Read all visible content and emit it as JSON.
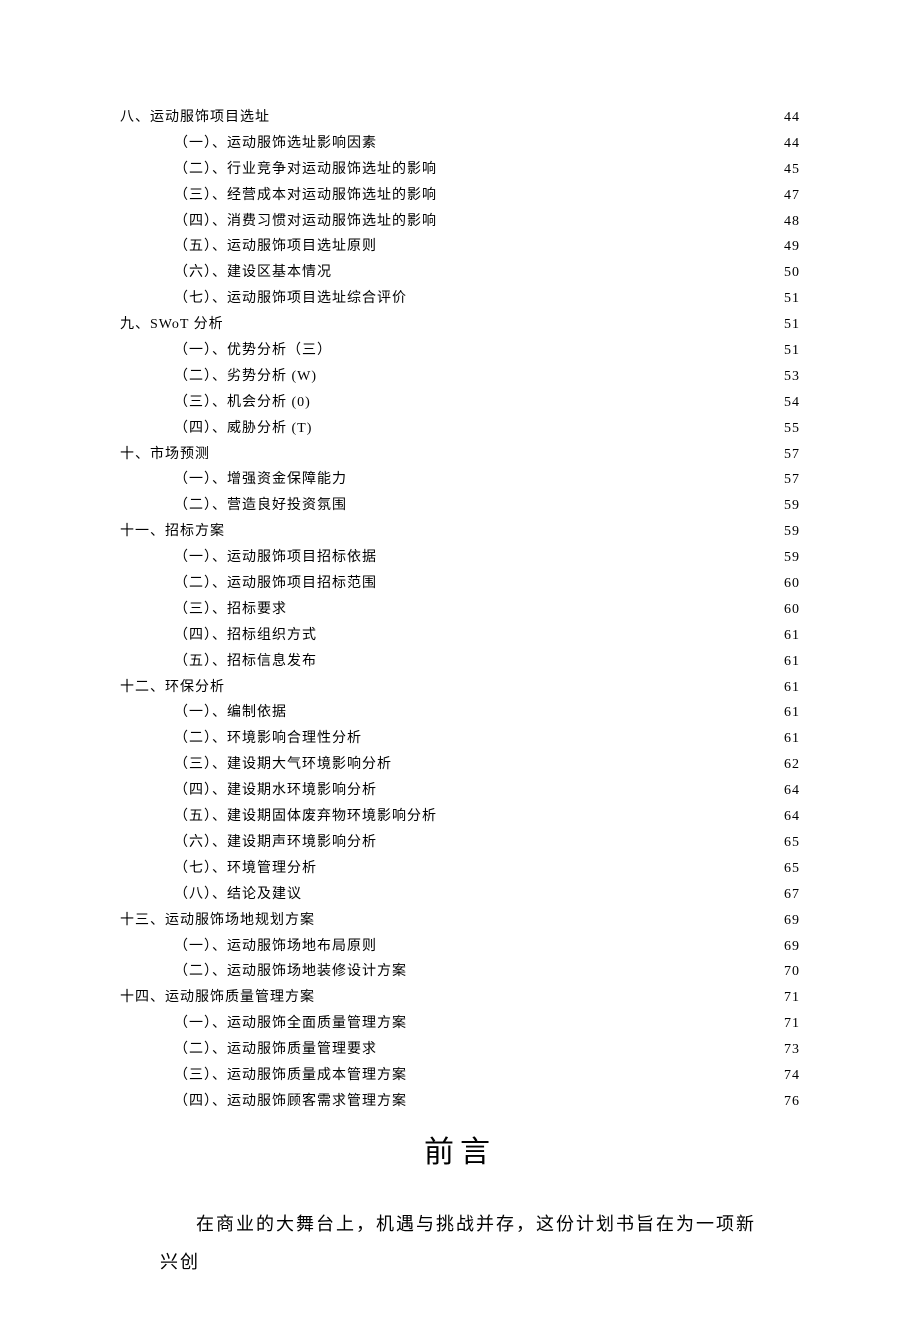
{
  "toc": [
    {
      "level": 0,
      "label": "八、运动服饰项目选址",
      "page": "44"
    },
    {
      "level": 1,
      "label": "（一）、运动服饰选址影响因素",
      "page": "44"
    },
    {
      "level": 1,
      "label": "（二）、行业竞争对运动服饰选址的影响",
      "page": "45"
    },
    {
      "level": 1,
      "label": "（三）、经营成本对运动服饰选址的影响",
      "page": "47"
    },
    {
      "level": 1,
      "label": "（四）、消费习惯对运动服饰选址的影响",
      "page": "48"
    },
    {
      "level": 1,
      "label": "（五）、运动服饰项目选址原则",
      "page": "49"
    },
    {
      "level": 1,
      "label": "（六）、建设区基本情况",
      "page": "50"
    },
    {
      "level": 1,
      "label": "（七）、运动服饰项目选址综合评价",
      "page": "51"
    },
    {
      "level": 0,
      "label": "九、SWoT 分析",
      "page": "51"
    },
    {
      "level": 1,
      "label": "（一）、优势分析（三）",
      "page": "51"
    },
    {
      "level": 1,
      "label": "（二）、劣势分析 (W)",
      "page": "53"
    },
    {
      "level": 1,
      "label": "（三）、机会分析 (0)",
      "page": "54"
    },
    {
      "level": 1,
      "label": "（四）、威胁分析 (T)",
      "page": "55"
    },
    {
      "level": 0,
      "label": "十、市场预测",
      "page": "57"
    },
    {
      "level": 1,
      "label": "（一）、增强资金保障能力",
      "page": "57"
    },
    {
      "level": 1,
      "label": "（二）、营造良好投资氛围",
      "page": "59"
    },
    {
      "level": 0,
      "label": "十一、招标方案",
      "page": "59"
    },
    {
      "level": 1,
      "label": "（一）、运动服饰项目招标依据",
      "page": "59"
    },
    {
      "level": 1,
      "label": "（二）、运动服饰项目招标范围",
      "page": "60"
    },
    {
      "level": 1,
      "label": "（三）、招标要求",
      "page": "60"
    },
    {
      "level": 1,
      "label": "（四）、招标组织方式",
      "page": "61"
    },
    {
      "level": 1,
      "label": "（五）、招标信息发布",
      "page": "61"
    },
    {
      "level": 0,
      "label": "十二、环保分析",
      "page": "61"
    },
    {
      "level": 1,
      "label": "（一）、编制依据",
      "page": "61"
    },
    {
      "level": 1,
      "label": "（二）、环境影响合理性分析",
      "page": "61"
    },
    {
      "level": 1,
      "label": "（三）、建设期大气环境影响分析",
      "page": "62"
    },
    {
      "level": 1,
      "label": "（四）、建设期水环境影响分析",
      "page": "64"
    },
    {
      "level": 1,
      "label": "（五）、建设期固体废弃物环境影响分析",
      "page": "64"
    },
    {
      "level": 1,
      "label": "（六）、建设期声环境影响分析",
      "page": "65"
    },
    {
      "level": 1,
      "label": "（七）、环境管理分析",
      "page": "65"
    },
    {
      "level": 1,
      "label": "（八）、结论及建议",
      "page": "67"
    },
    {
      "level": 0,
      "label": "十三、运动服饰场地规划方案",
      "page": "69"
    },
    {
      "level": 1,
      "label": "（一）、运动服饰场地布局原则",
      "page": "69"
    },
    {
      "level": 1,
      "label": "（二）、运动服饰场地装修设计方案",
      "page": "70"
    },
    {
      "level": 0,
      "label": "十四、运动服饰质量管理方案",
      "page": "71"
    },
    {
      "level": 1,
      "label": "（一）、运动服饰全面质量管理方案",
      "page": "71"
    },
    {
      "level": 1,
      "label": "（二）、运动服饰质量管理要求",
      "page": "73"
    },
    {
      "level": 1,
      "label": "（三）、运动服饰质量成本管理方案",
      "page": "74"
    },
    {
      "level": 1,
      "label": "（四）、运动服饰顾客需求管理方案",
      "page": "76"
    }
  ],
  "heading": "前言",
  "body": "在商业的大舞台上，机遇与挑战并存，这份计划书旨在为一项新兴创"
}
